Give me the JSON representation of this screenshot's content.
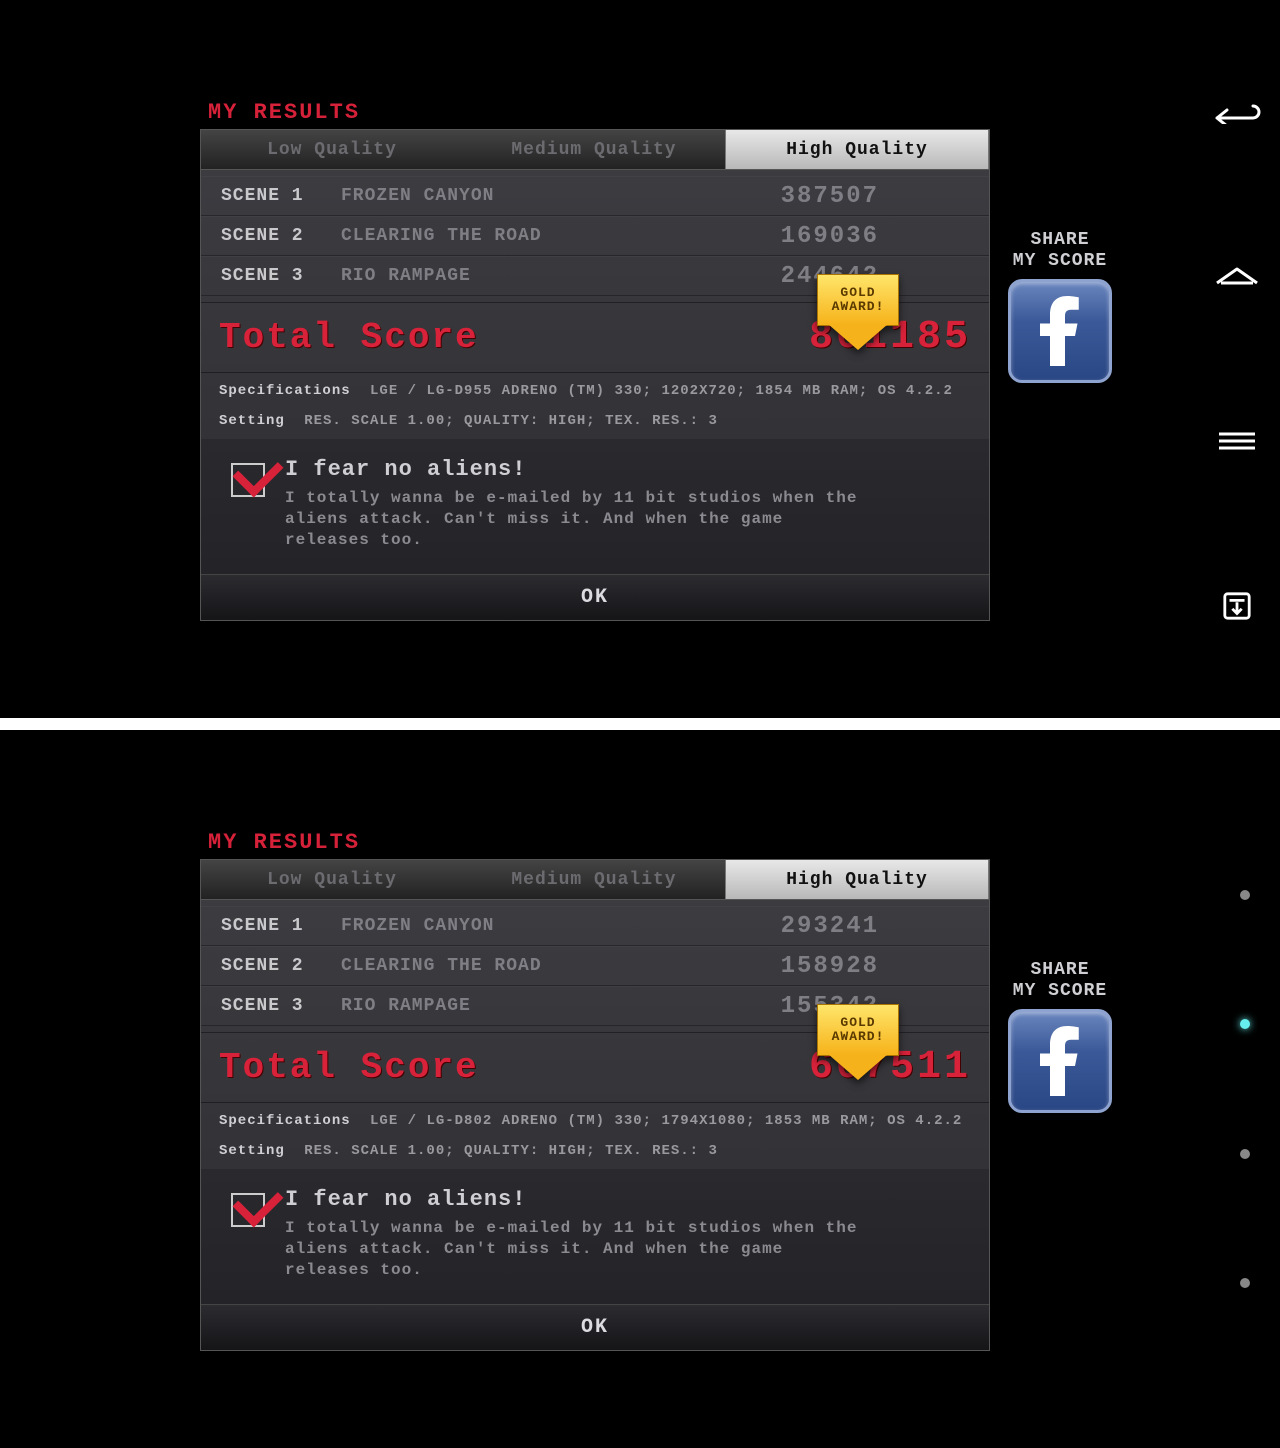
{
  "shots": [
    {
      "title": "MY RESULTS",
      "tabs": {
        "low": "Low Quality",
        "med": "Medium Quality",
        "high": "High Quality",
        "active": "high"
      },
      "scenes": [
        {
          "label": "SCENE 1",
          "name": "FROZEN CANYON",
          "score": "387507"
        },
        {
          "label": "SCENE 2",
          "name": "CLEARING THE ROAD",
          "score": "169036"
        },
        {
          "label": "SCENE 3",
          "name": "RIO RAMPAGE",
          "score": "244642"
        }
      ],
      "total_label": "Total Score",
      "total_score": "801185",
      "award": {
        "line1": "GOLD",
        "line2": "AWARD!"
      },
      "spec_label": "Specifications",
      "spec_value": "LGE / LG-D955 ADRENO (TM) 330; 1202X720; 1854 MB RAM; OS 4.2.2",
      "set_label": "Setting",
      "set_value": "RES. SCALE 1.00; QUALITY: HIGH; TEX. RES.: 3",
      "optin_title": "I fear no aliens!",
      "optin_body": "I totally wanna be e-mailed by 11 bit studios when the aliens attack. Can't miss it. And when the game releases too.",
      "ok": "OK",
      "share1": "SHARE",
      "share2": "MY SCORE",
      "nav_style": "icons"
    },
    {
      "title": "MY RESULTS",
      "tabs": {
        "low": "Low Quality",
        "med": "Medium Quality",
        "high": "High Quality",
        "active": "high"
      },
      "scenes": [
        {
          "label": "SCENE 1",
          "name": "FROZEN CANYON",
          "score": "293241"
        },
        {
          "label": "SCENE 2",
          "name": "CLEARING THE ROAD",
          "score": "158928"
        },
        {
          "label": "SCENE 3",
          "name": "RIO RAMPAGE",
          "score": "155342"
        }
      ],
      "total_label": "Total Score",
      "total_score": "607511",
      "award": {
        "line1": "GOLD",
        "line2": "AWARD!"
      },
      "spec_label": "Specifications",
      "spec_value": "LGE / LG-D802 ADRENO (TM) 330; 1794X1080; 1853 MB RAM; OS 4.2.2",
      "set_label": "Setting",
      "set_value": "RES. SCALE 1.00; QUALITY: HIGH; TEX. RES.: 3",
      "optin_title": "I fear no aliens!",
      "optin_body": "I totally wanna be e-mailed by 11 bit studios when the aliens attack. Can't miss it. And when the game releases too.",
      "ok": "OK",
      "share1": "SHARE",
      "share2": "MY SCORE",
      "nav_style": "dots"
    }
  ]
}
